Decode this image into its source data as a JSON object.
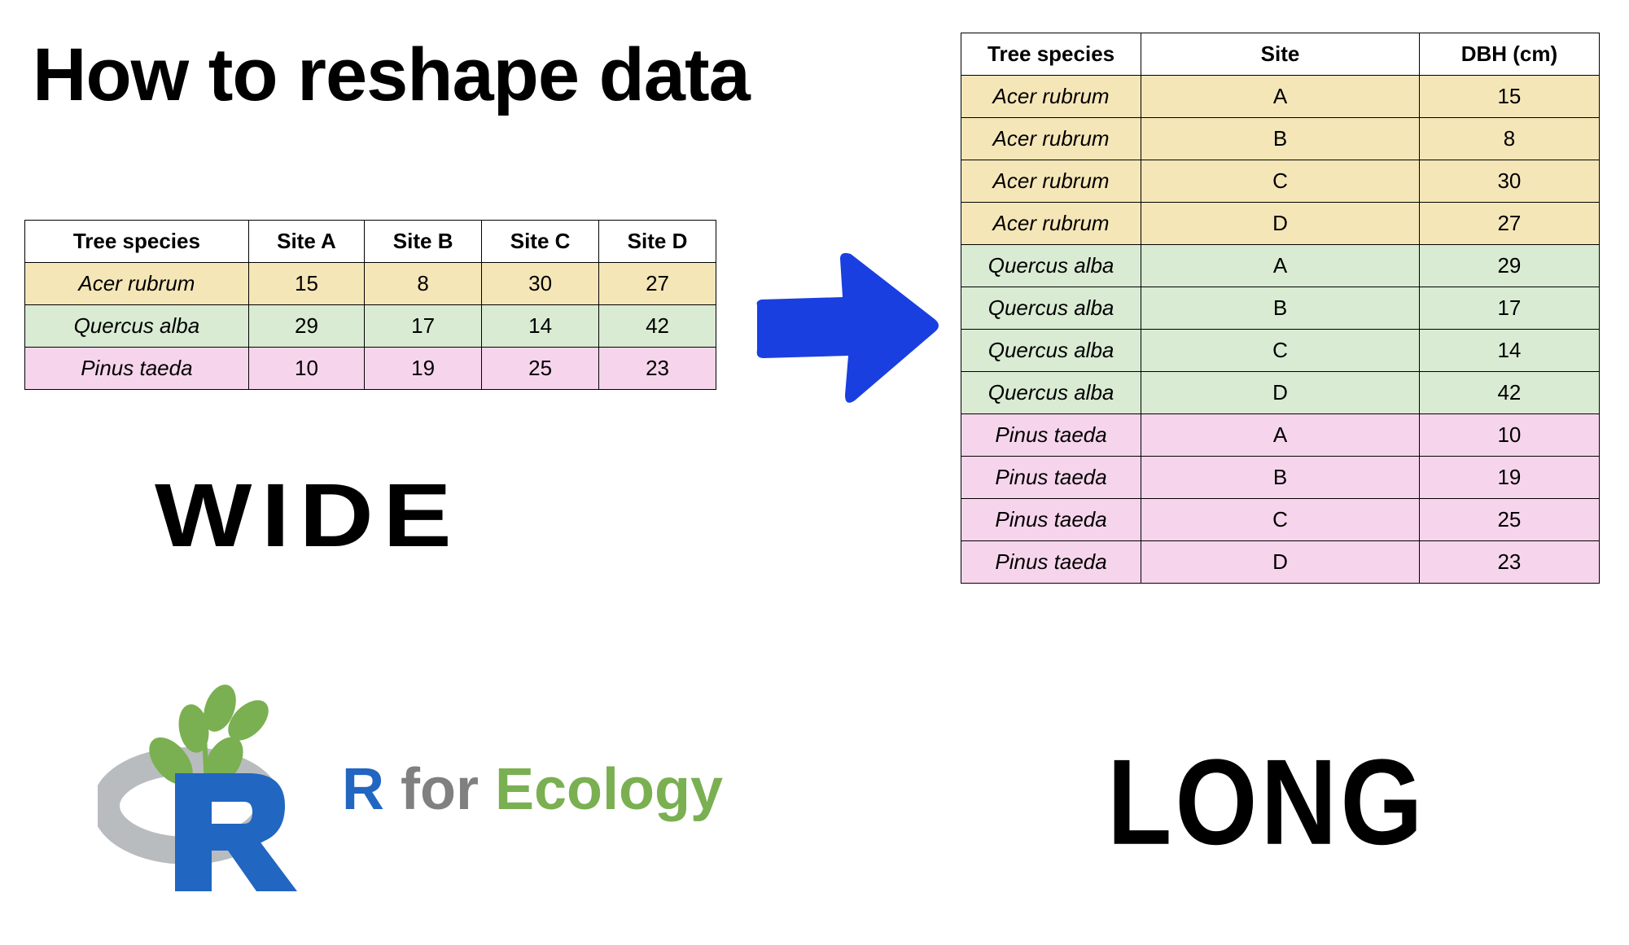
{
  "title": "How to reshape data",
  "wide_label": "WIDE",
  "long_label": "LONG",
  "brand": {
    "r": "R",
    "for": " for ",
    "eco": "Ecology"
  },
  "colors": {
    "yellow": "#f5e6b8",
    "green": "#d9ebd3",
    "pink": "#f6d5ec",
    "arrow": "#1a3fe0",
    "brand_blue": "#2166c1",
    "brand_green": "#7ab051",
    "brand_gray": "#808080"
  },
  "wide_table": {
    "headers": [
      "Tree species",
      "Site A",
      "Site B",
      "Site C",
      "Site D"
    ],
    "rows": [
      {
        "color": "yellow",
        "cells": [
          "Acer rubrum",
          "15",
          "8",
          "30",
          "27"
        ]
      },
      {
        "color": "green",
        "cells": [
          "Quercus alba",
          "29",
          "17",
          "14",
          "42"
        ]
      },
      {
        "color": "pink",
        "cells": [
          "Pinus taeda",
          "10",
          "19",
          "25",
          "23"
        ]
      }
    ]
  },
  "long_table": {
    "headers": [
      "Tree species",
      "Site",
      "DBH (cm)"
    ],
    "rows": [
      {
        "color": "yellow",
        "cells": [
          "Acer rubrum",
          "A",
          "15"
        ]
      },
      {
        "color": "yellow",
        "cells": [
          "Acer rubrum",
          "B",
          "8"
        ]
      },
      {
        "color": "yellow",
        "cells": [
          "Acer rubrum",
          "C",
          "30"
        ]
      },
      {
        "color": "yellow",
        "cells": [
          "Acer rubrum",
          "D",
          "27"
        ]
      },
      {
        "color": "green",
        "cells": [
          "Quercus alba",
          "A",
          "29"
        ]
      },
      {
        "color": "green",
        "cells": [
          "Quercus alba",
          "B",
          "17"
        ]
      },
      {
        "color": "green",
        "cells": [
          "Quercus alba",
          "C",
          "14"
        ]
      },
      {
        "color": "green",
        "cells": [
          "Quercus alba",
          "D",
          "42"
        ]
      },
      {
        "color": "pink",
        "cells": [
          "Pinus taeda",
          "A",
          "10"
        ]
      },
      {
        "color": "pink",
        "cells": [
          "Pinus taeda",
          "B",
          "19"
        ]
      },
      {
        "color": "pink",
        "cells": [
          "Pinus taeda",
          "C",
          "25"
        ]
      },
      {
        "color": "pink",
        "cells": [
          "Pinus taeda",
          "D",
          "23"
        ]
      }
    ]
  },
  "chart_data": [
    {
      "type": "table",
      "title": "Wide format",
      "columns": [
        "Tree species",
        "Site A",
        "Site B",
        "Site C",
        "Site D"
      ],
      "rows": [
        [
          "Acer rubrum",
          15,
          8,
          30,
          27
        ],
        [
          "Quercus alba",
          29,
          17,
          14,
          42
        ],
        [
          "Pinus taeda",
          10,
          19,
          25,
          23
        ]
      ]
    },
    {
      "type": "table",
      "title": "Long format",
      "columns": [
        "Tree species",
        "Site",
        "DBH (cm)"
      ],
      "rows": [
        [
          "Acer rubrum",
          "A",
          15
        ],
        [
          "Acer rubrum",
          "B",
          8
        ],
        [
          "Acer rubrum",
          "C",
          30
        ],
        [
          "Acer rubrum",
          "D",
          27
        ],
        [
          "Quercus alba",
          "A",
          29
        ],
        [
          "Quercus alba",
          "B",
          17
        ],
        [
          "Quercus alba",
          "C",
          14
        ],
        [
          "Quercus alba",
          "D",
          42
        ],
        [
          "Pinus taeda",
          "A",
          10
        ],
        [
          "Pinus taeda",
          "B",
          19
        ],
        [
          "Pinus taeda",
          "C",
          25
        ],
        [
          "Pinus taeda",
          "D",
          23
        ]
      ]
    }
  ]
}
